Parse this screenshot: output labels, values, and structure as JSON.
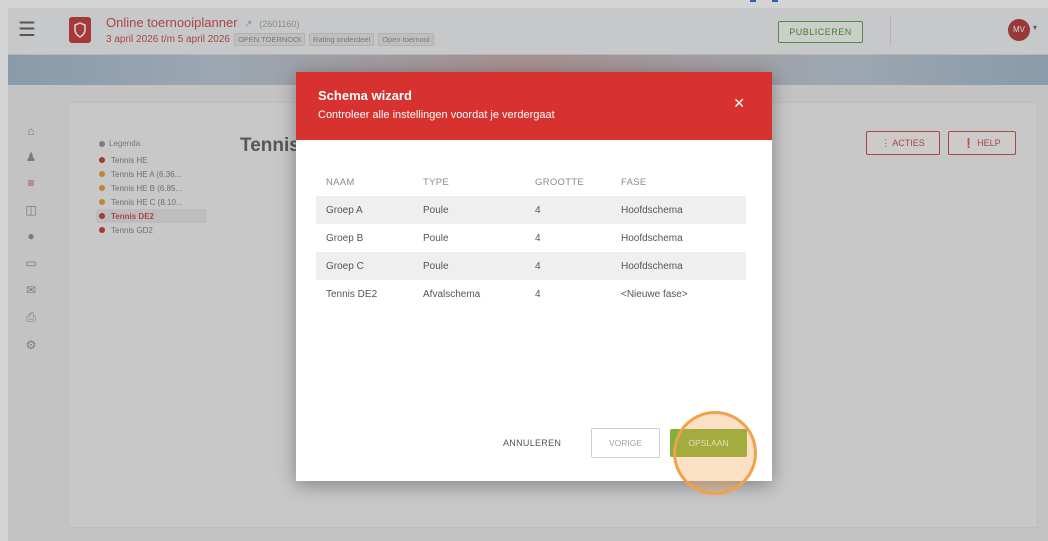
{
  "header": {
    "app_title": "Online toernooiplanner",
    "tournament_id": "(2601160)",
    "dates": "3 april 2026 t/m 5 april 2026",
    "tags": [
      "OPEN TOERNOOI",
      "Rating onderdeel",
      "Open toernooi"
    ],
    "publish_label": "PUBLICEREN",
    "avatar_initials": "MV"
  },
  "sidebar_icons": [
    "home-icon",
    "users-icon",
    "list-icon",
    "tree-icon",
    "circle-icon",
    "monitor-icon",
    "mail-icon",
    "print-icon",
    "gear-icon"
  ],
  "legend": {
    "title": "Legenda",
    "items": [
      {
        "label": "Tennis HE",
        "color": "red"
      },
      {
        "label": "Tennis HE A (6.36...",
        "color": "orange"
      },
      {
        "label": "Tennis HE B (6.85...",
        "color": "orange"
      },
      {
        "label": "Tennis HE C (8.10...",
        "color": "orange"
      },
      {
        "label": "Tennis DE2",
        "color": "red",
        "selected": true
      },
      {
        "label": "Tennis GD2",
        "color": "red"
      }
    ]
  },
  "section_title": "Tennis",
  "actions_label": "ACTIES",
  "help_label": "HELP",
  "modal": {
    "title": "Schema wizard",
    "subtitle": "Controleer alle instellingen voordat je verdergaat",
    "columns": [
      "NAAM",
      "TYPE",
      "GROOTTE",
      "FASE"
    ],
    "rows": [
      {
        "naam": "Groep A",
        "type": "Poule",
        "grootte": "4",
        "fase": "Hoofdschema"
      },
      {
        "naam": "Groep B",
        "type": "Poule",
        "grootte": "4",
        "fase": "Hoofdschema"
      },
      {
        "naam": "Groep C",
        "type": "Poule",
        "grootte": "4",
        "fase": "Hoofdschema"
      },
      {
        "naam": "Tennis DE2",
        "type": "Afvalschema",
        "grootte": "4",
        "fase": "<Nieuwe fase>"
      }
    ],
    "cancel_label": "ANNULEREN",
    "prev_label": "VORIGE",
    "save_label": "OPSLAAN"
  },
  "colors": {
    "brand_red": "#d7322f",
    "save_green": "#7eb23a",
    "highlight_orange": "#f0a14a"
  }
}
